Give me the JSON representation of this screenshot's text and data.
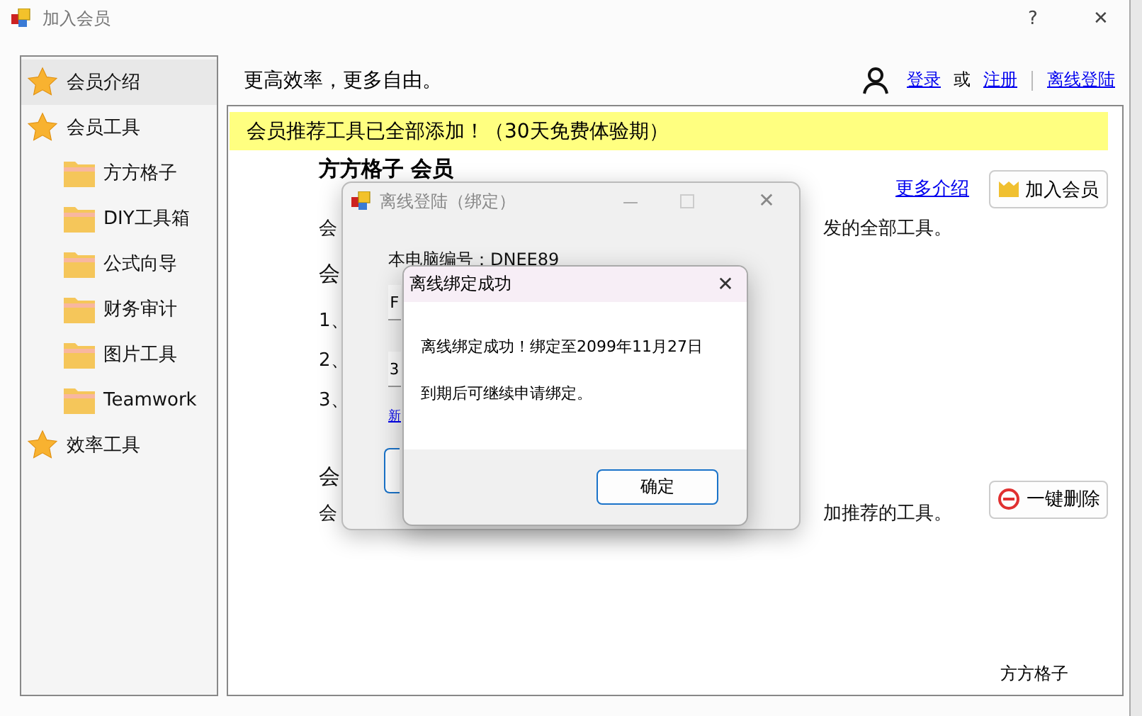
{
  "window": {
    "title": "加入会员",
    "help": "?",
    "close": "✕"
  },
  "sidebar": {
    "items": [
      {
        "label": "会员介绍",
        "kind": "star",
        "selected": true
      },
      {
        "label": "会员工具",
        "kind": "star",
        "selected": false,
        "children": [
          {
            "label": "方方格子",
            "kind": "folder",
            "selected": false
          },
          {
            "label": "DIY工具箱",
            "kind": "folder",
            "selected": false
          },
          {
            "label": "公式向导",
            "kind": "folder",
            "selected": false
          },
          {
            "label": "财务审计",
            "kind": "folder",
            "selected": false
          },
          {
            "label": "图片工具",
            "kind": "folder",
            "selected": false
          },
          {
            "label": "Teamwork",
            "kind": "folder",
            "selected": false
          }
        ]
      },
      {
        "label": "效率工具",
        "kind": "star",
        "selected": false
      }
    ]
  },
  "header": {
    "slogan": "更高效率，更多自由。",
    "login": "登录",
    "or": "或",
    "register": "注册",
    "offline": "离线登陆"
  },
  "banner": "会员推荐工具已全部添加！（30天免费体验期）",
  "content": {
    "heading": "方方格子 会员",
    "more": "更多介绍",
    "join_button": "加入会员",
    "row1_start": "会",
    "row1_end": "发的全部工具。",
    "row2_start": "会",
    "steps": [
      "1、",
      "2、",
      "3、"
    ],
    "row3_start": "会",
    "row4_start": "会",
    "row4_end": "加推荐的工具。",
    "delete_button": "一键删除",
    "footer": "方方格子"
  },
  "offline_dialog": {
    "title": "离线登陆（绑定）",
    "minimize": "—",
    "close": "✕",
    "machine_id": "本电脑编号：DNEE89",
    "field_1": "F",
    "field_2": "3",
    "link": "新"
  },
  "message_box": {
    "title": "离线绑定成功",
    "close": "✕",
    "lines": [
      "离线绑定成功！绑定至2099年11月27日",
      "到期后可继续申请绑定。"
    ],
    "ok": "确定"
  }
}
